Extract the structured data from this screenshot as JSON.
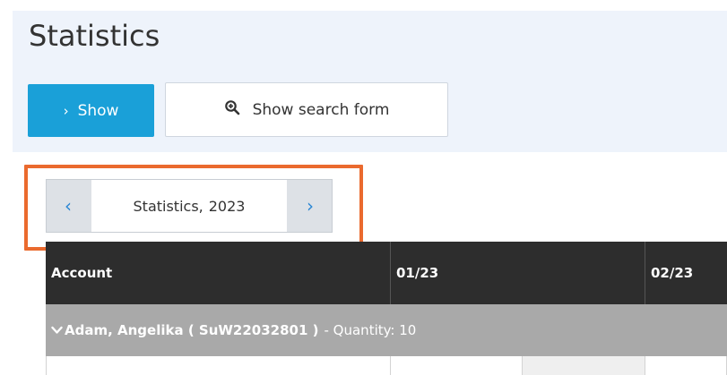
{
  "page": {
    "title": "Statistics"
  },
  "toolbar": {
    "show_icon": "chevron-right-icon",
    "show_label": "Show",
    "search_icon": "zoom-in-icon",
    "search_label": "Show search form"
  },
  "year_nav": {
    "prev_icon": "chevron-left-icon",
    "label": "Statistics,",
    "year": "2023",
    "next_icon": "chevron-right-icon"
  },
  "table": {
    "columns": [
      "Account",
      "01/23",
      "02/23"
    ],
    "groups": [
      {
        "caret_icon": "chevron-down-icon",
        "name": "Adam, Angelika ( SuW22032801 )",
        "quantity_label": "- Quantity: 10"
      }
    ]
  },
  "colors": {
    "primary_button": "#1aa0d8",
    "highlight": "#ea6a2e",
    "header_bg": "#2d2d2d",
    "group_bg": "#a9a9a9",
    "nav_arrow": "#2a86d4"
  }
}
